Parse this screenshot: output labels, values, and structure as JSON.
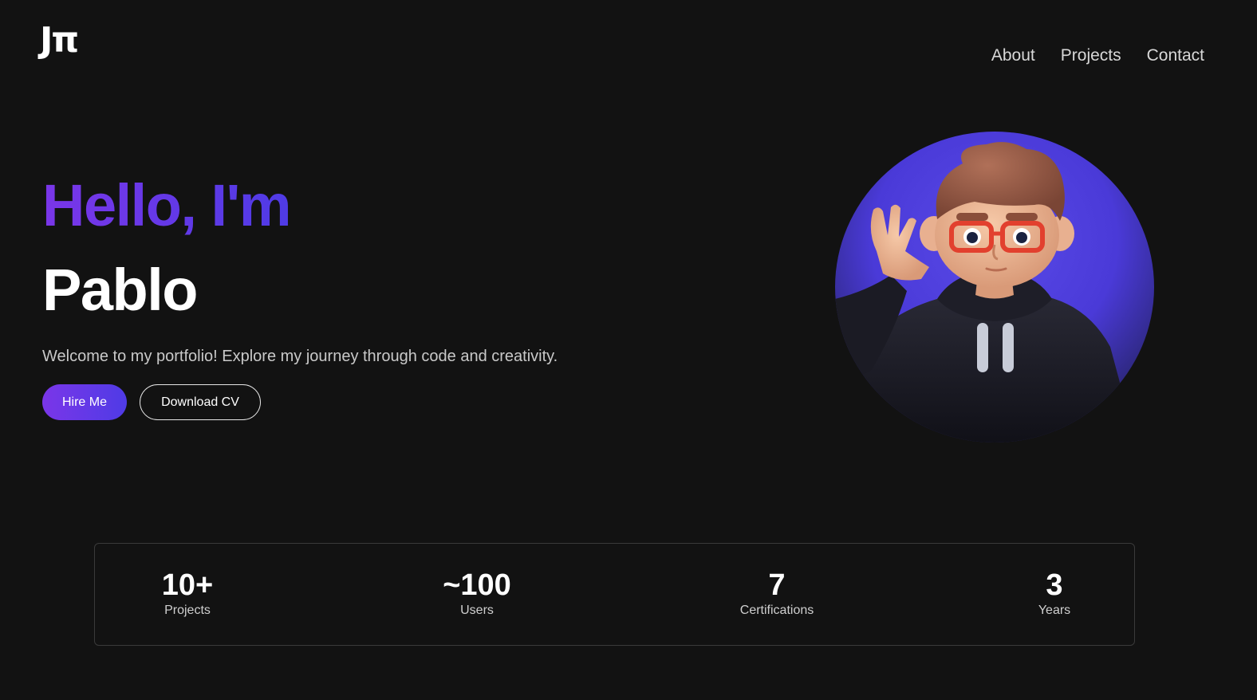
{
  "header": {
    "logo": "Jπ",
    "nav": [
      {
        "label": "About"
      },
      {
        "label": "Projects"
      },
      {
        "label": "Contact"
      }
    ]
  },
  "hero": {
    "greeting": "Hello, I'm",
    "name": "Pablo",
    "tagline": "Welcome to my portfolio! Explore my journey through code and creativity.",
    "primary_button": "Hire Me",
    "secondary_button": "Download CV",
    "avatar_icon": "waving-3d-avatar-icon"
  },
  "stats": [
    {
      "value": "10+",
      "label": "Projects"
    },
    {
      "value": "~100",
      "label": "Users"
    },
    {
      "value": "7",
      "label": "Certifications"
    },
    {
      "value": "3",
      "label": "Years"
    }
  ],
  "colors": {
    "background": "#121212",
    "accent_start": "#7a36e8",
    "accent_end": "#4f3be6",
    "text_muted": "#c9c9c9",
    "border": "#3a3a3a"
  }
}
